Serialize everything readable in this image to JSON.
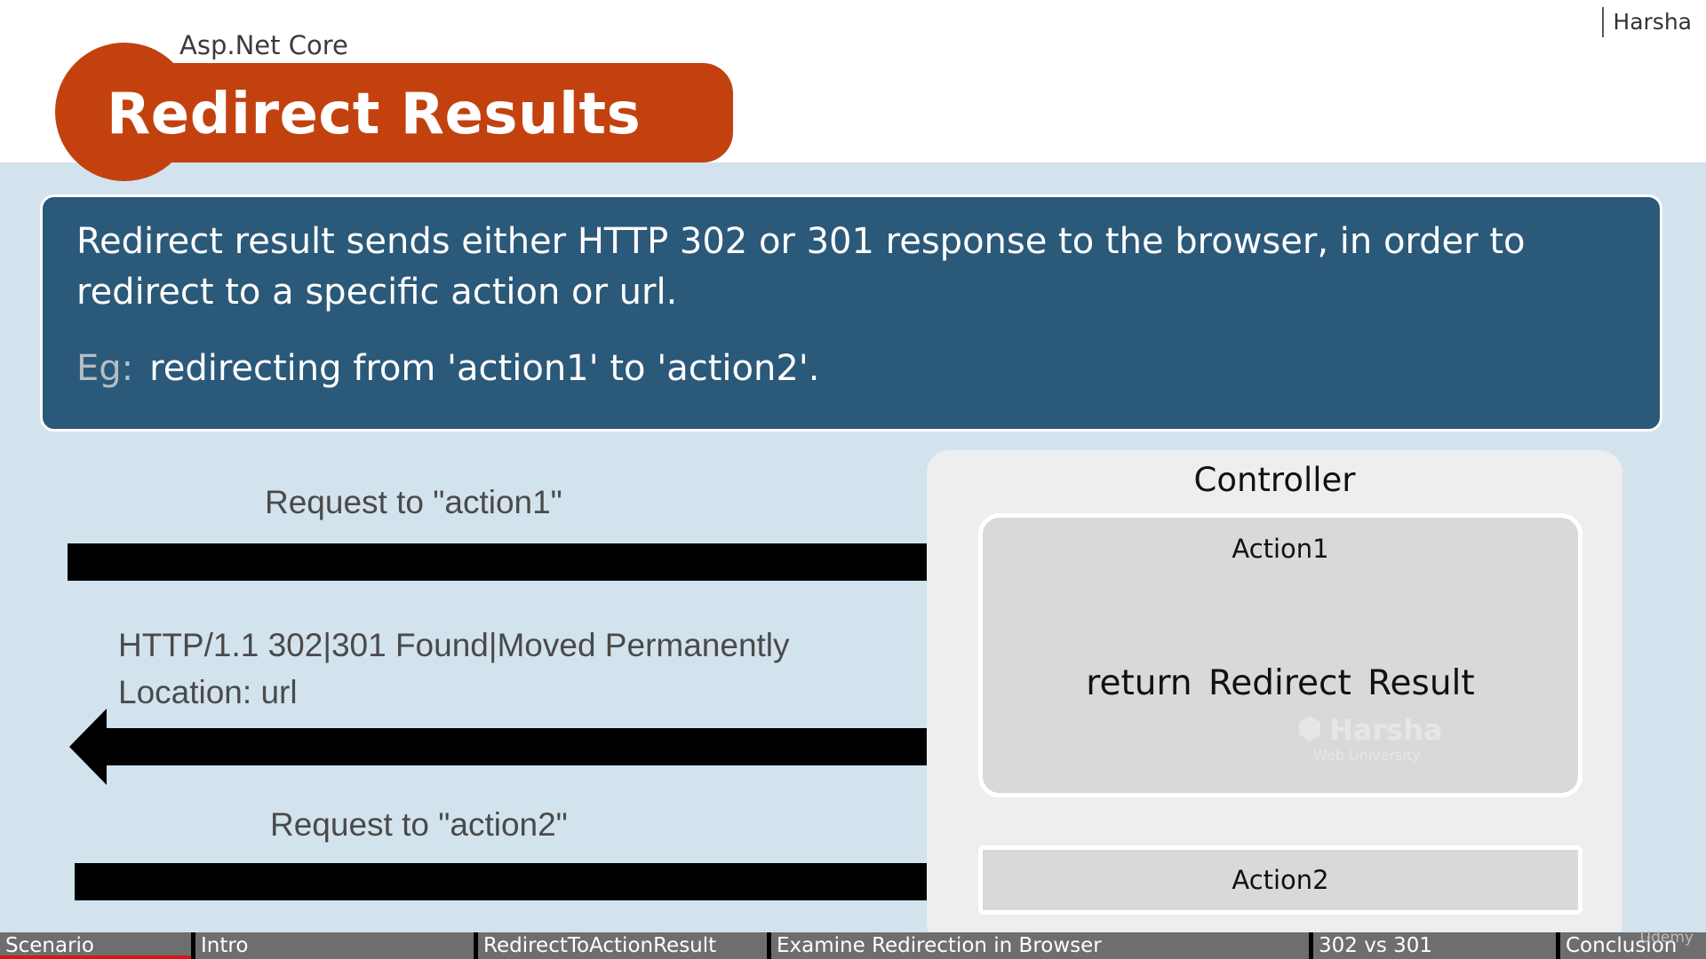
{
  "header": {
    "presenter": "Harsha",
    "subtitle": "Asp.Net Core",
    "title": "Redirect Results"
  },
  "info": {
    "description": "Redirect result sends either HTTP 302 or 301 response to the browser, in order to redirect to a specific action or url.",
    "example_label": "Eg:",
    "example_text": "redirecting from 'action1' to 'action2'."
  },
  "diagram": {
    "request1_label": "Request to \"action1\"",
    "response_line1": "HTTP/1.1  302|301  Found|Moved Permanently",
    "response_line2": "Location: url",
    "request2_label": "Request to \"action2\"",
    "controller_title": "Controller",
    "action1_title": "Action1",
    "action1_body": "return  Redirect Result",
    "action2_title": "Action2",
    "watermark_name": "Harsha",
    "watermark_sub": "Web University"
  },
  "chapters": [
    {
      "label": "Scenario"
    },
    {
      "label": "Intro"
    },
    {
      "label": "RedirectToActionResult"
    },
    {
      "label": "Examine Redirection in Browser"
    },
    {
      "label": "302 vs 301"
    },
    {
      "label": "Conclusion"
    }
  ],
  "player": {
    "brand": "Udemy"
  },
  "colors": {
    "title_accent": "#c3410f",
    "info_box": "#2b5979",
    "slide_background": "#d3e3ee",
    "progress": "#d11a1a"
  }
}
